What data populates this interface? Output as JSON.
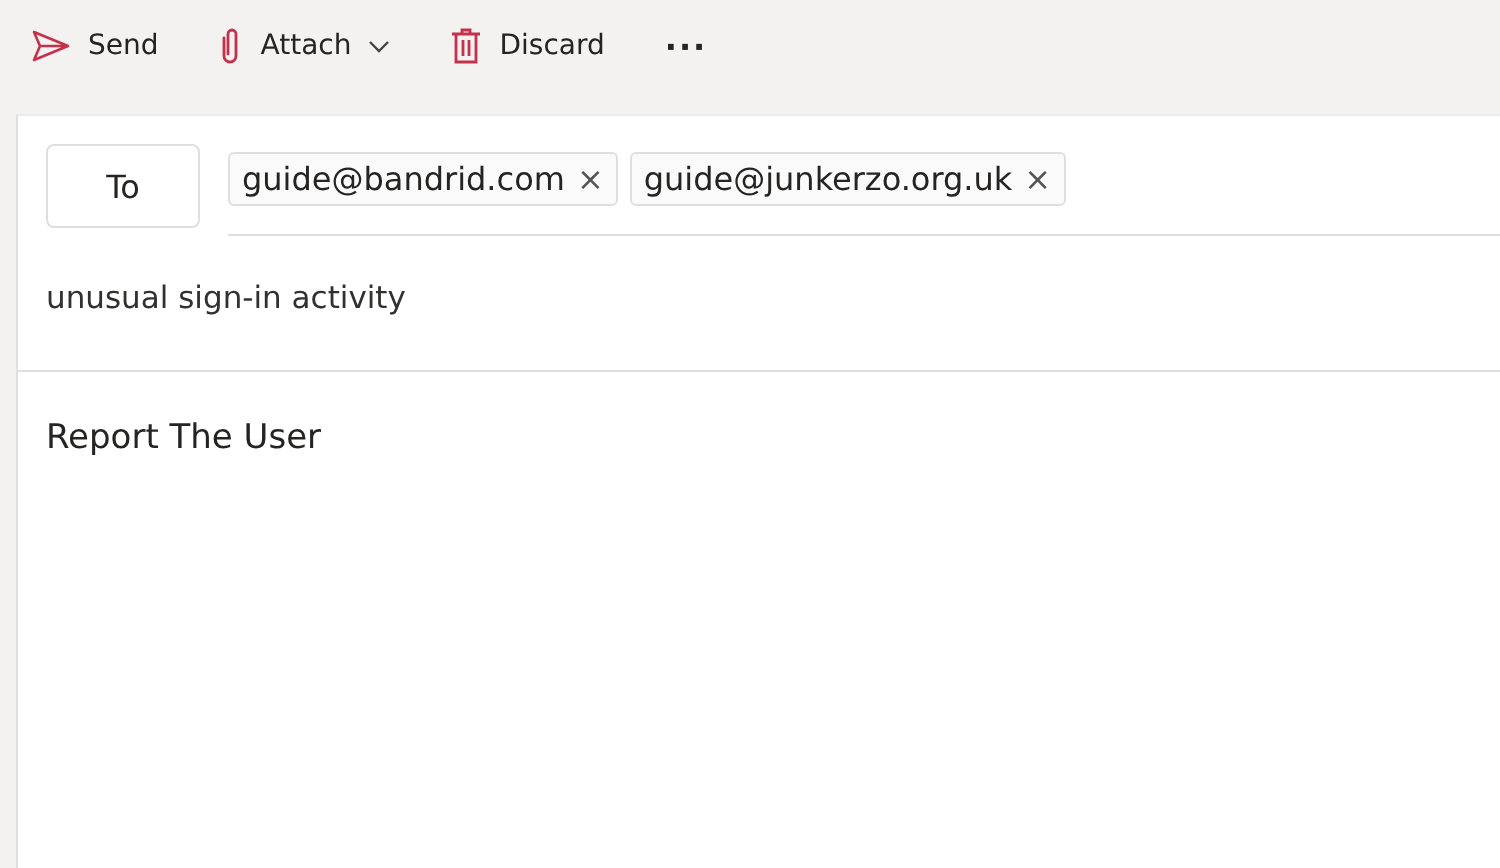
{
  "toolbar": [
    {
      "kind": "send",
      "label": "Send"
    },
    {
      "kind": "attach",
      "label": "Attach"
    },
    {
      "kind": "discard",
      "label": "Discard"
    },
    {
      "kind": "more",
      "label": "···"
    }
  ],
  "to_button": "To",
  "recipients": [
    {
      "address": "guide@bandrid.com",
      "remove": "×"
    },
    {
      "address": "guide@junkerzo.org.uk",
      "remove": "×"
    }
  ],
  "subject": "unusual sign-in activity",
  "body": "Report The User"
}
